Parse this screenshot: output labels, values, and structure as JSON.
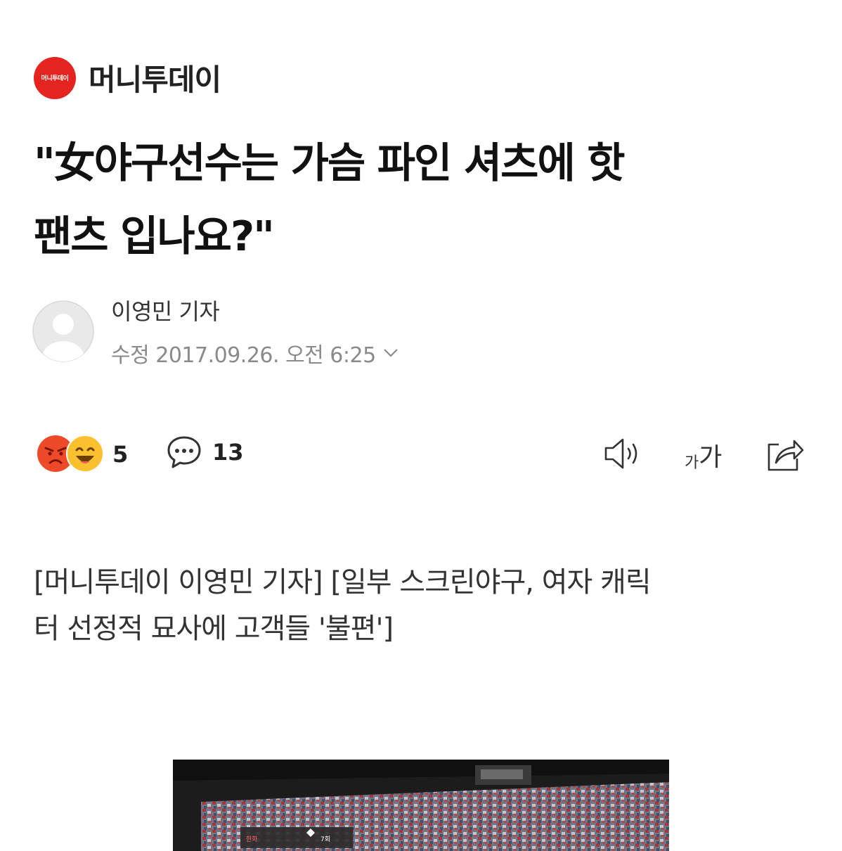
{
  "press": {
    "logo_text": "머니투데이",
    "name": "머니투데이",
    "logo_color": "#e5231f"
  },
  "article": {
    "headline_line1": "\"女야구선수는 가슴 파인 셔츠에 핫",
    "headline_line2": "팬츠 입나요?\"",
    "reporter": "이영민 기자",
    "dateline": "수정 2017.09.26. 오전 6:25",
    "body_line1": "[머니투데이 이영민 기자] [일부 스크린야구, 여자 캐릭",
    "body_line2": "터 선정적 묘사에 고객들 '불편']"
  },
  "toolbar": {
    "reaction_count": "5",
    "comment_count": "13",
    "font_size_small": "가",
    "font_size_large": "가",
    "icons": [
      "angry-emoji-icon",
      "laugh-emoji-icon",
      "comment-icon",
      "speaker-icon",
      "share-icon"
    ]
  },
  "photo": {
    "scoreboard_teams": [
      "한화",
      "7회"
    ]
  }
}
